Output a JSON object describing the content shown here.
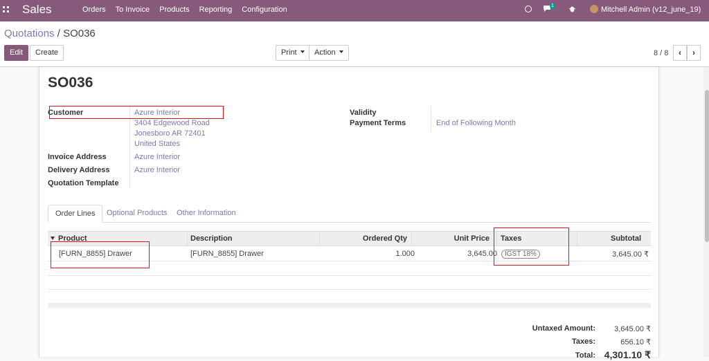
{
  "navbar": {
    "app_name": "Sales",
    "menu": [
      "Orders",
      "To Invoice",
      "Products",
      "Reporting",
      "Configuration"
    ],
    "chat_badge": "1",
    "user": "Mitchell Admin (v12_june_19)"
  },
  "control": {
    "breadcrumb_parent": "Quotations",
    "breadcrumb_sep": " / ",
    "breadcrumb_current": "SO036",
    "edit_label": "Edit",
    "create_label": "Create",
    "print_label": "Print",
    "action_label": "Action",
    "pager": "8 / 8",
    "prev_glyph": "‹",
    "next_glyph": "›"
  },
  "form": {
    "title": "SO036",
    "customer_label": "Customer",
    "customer_name": "Azure Interior",
    "address_line1": "3404 Edgewood Road",
    "address_line2": "Jonesboro AR 72401",
    "address_line3": "United States",
    "invoice_address_label": "Invoice Address",
    "invoice_address": "Azure Interior",
    "delivery_address_label": "Delivery Address",
    "delivery_address": "Azure Interior",
    "template_label": "Quotation Template",
    "validity_label": "Validity",
    "payment_terms_label": "Payment Terms",
    "payment_terms": "End of Following Month"
  },
  "tabs": [
    "Order Lines",
    "Optional Products",
    "Other Information"
  ],
  "table": {
    "columns": [
      "Product",
      "Description",
      "Ordered Qty",
      "Unit Price",
      "Taxes",
      "Subtotal"
    ],
    "rows": [
      {
        "product": "[FURN_8855] Drawer",
        "description": "[FURN_8855] Drawer",
        "qty": "1.000",
        "unit_price": "3,645.00",
        "tax": "IGST 18%",
        "subtotal": "3,645.00 ₹"
      }
    ]
  },
  "totals": {
    "untaxed_label": "Untaxed Amount:",
    "untaxed_value": "3,645.00 ₹",
    "taxes_label": "Taxes:",
    "taxes_value": "656.10 ₹",
    "total_label": "Total:",
    "total_value": "4,301.10 ₹"
  },
  "colors": {
    "brand": "#875a7b",
    "link": "#7c7bad",
    "highlight": "#e0101b"
  }
}
